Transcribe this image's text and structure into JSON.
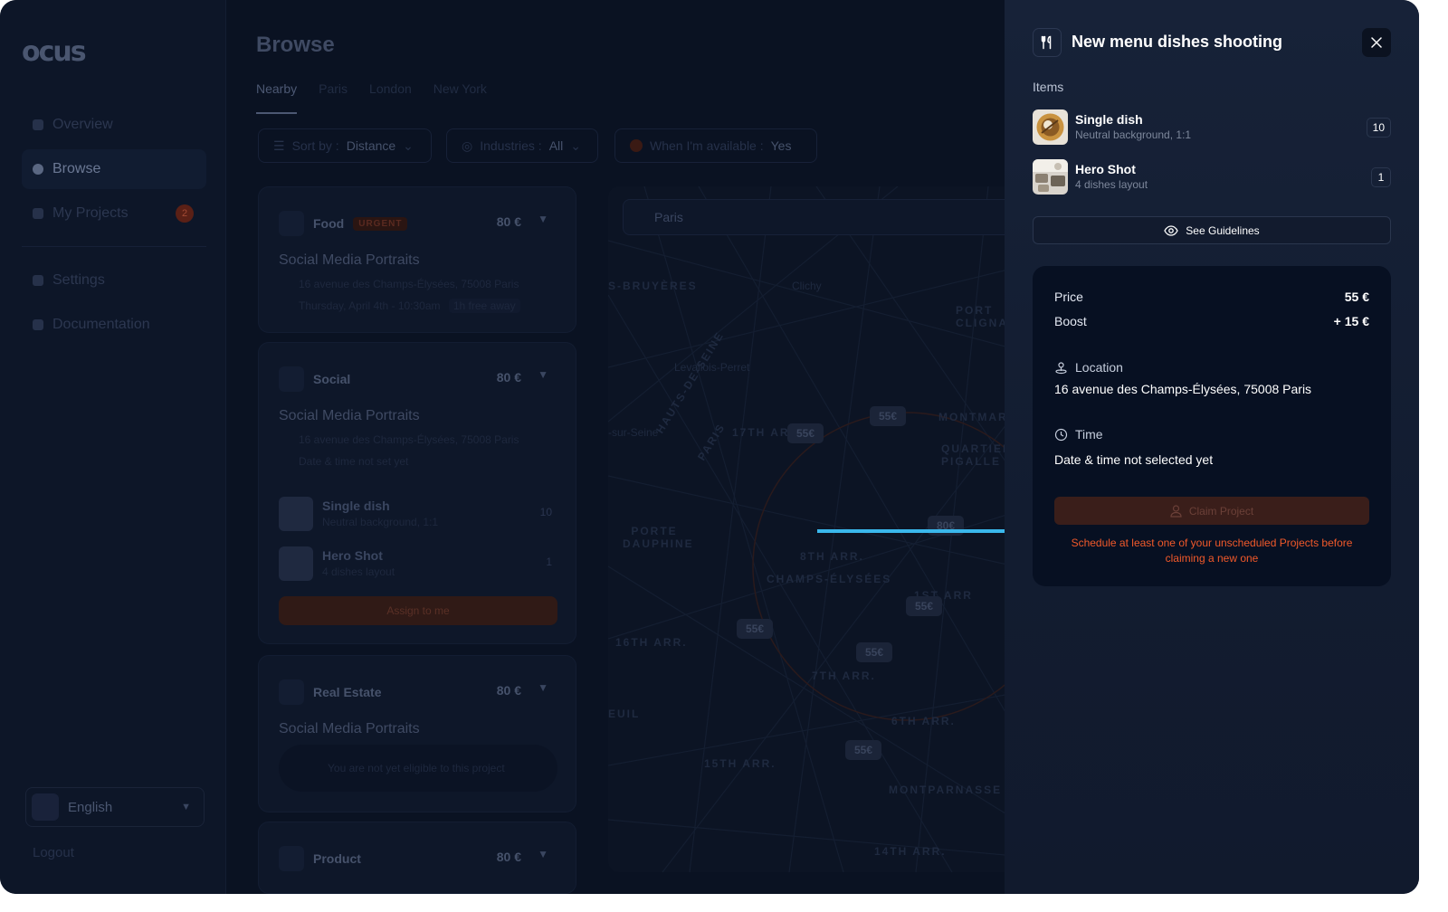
{
  "sidebar": {
    "logo": "ocus",
    "nav": [
      {
        "label": "Overview"
      },
      {
        "label": "Browse"
      },
      {
        "label": "My Projects",
        "badge": "2"
      },
      {
        "label": "Settings"
      },
      {
        "label": "Documentation"
      }
    ],
    "language": "English",
    "logout": "Logout"
  },
  "browse": {
    "title": "Browse",
    "tabs": [
      "Nearby",
      "Paris",
      "London",
      "New York"
    ],
    "filters": {
      "sort_prefix": "Sort by :",
      "sort_value": "Distance",
      "industries_prefix": "Industries :",
      "industries_value": "All",
      "availability_prefix": "When I'm available :",
      "availability_value": "Yes"
    },
    "cards": [
      {
        "category": "Food",
        "urgent": "URGENT",
        "price": "80 €",
        "title": "Social Media Portraits",
        "address": "16 avenue des Champs-Élysées, 75008 Paris",
        "time": "Thursday, April 4th - 10:30am",
        "tag": "1h free away"
      },
      {
        "category": "Social",
        "price": "80 €",
        "title": "Social Media Portraits",
        "address": "16 avenue des Champs-Élysées, 75008 Paris",
        "time": "Date & time not set yet",
        "items": [
          {
            "name": "Single dish",
            "desc": "Neutral background, 1:1",
            "qty": "10"
          },
          {
            "name": "Hero Shot",
            "desc": "4 dishes layout",
            "qty": "1"
          }
        ],
        "assign": "Assign to me"
      },
      {
        "category": "Real Estate",
        "price": "80 €",
        "title": "Social Media Portraits",
        "not_eligible": "You are not yet eligible to this project"
      },
      {
        "category": "Product",
        "price": "80 €"
      }
    ],
    "map": {
      "search": "Paris",
      "labels": [
        "S-BRUYÈRES",
        "Clichy",
        "PORT CLIGNAN",
        "Levallois-Perret",
        "MONTMART",
        "QUARTIER PIGALLE",
        "17TH AR",
        "-sur-Seine",
        "HAUTS-DE-SEINE",
        "PARIS",
        "PORTE DAUPHINE",
        "8TH ARR.",
        "CHAMPS-ÉLYSÉES",
        "1ST ARR",
        "16TH ARR.",
        "7TH ARR.",
        "6TH ARR.",
        "EUIL",
        "15TH ARR.",
        "MONTPARNASSE",
        "14TH ARR."
      ],
      "pins": [
        "55€",
        "55€",
        "80€",
        "55€",
        "55€",
        "55€",
        "55€"
      ]
    }
  },
  "drawer": {
    "icon": "fork-knife-icon",
    "title": "New menu dishes shooting",
    "items_label": "Items",
    "items": [
      {
        "name": "Single dish",
        "desc": "Neutral background, 1:1",
        "qty": "10"
      },
      {
        "name": "Hero Shot",
        "desc": "4 dishes layout",
        "qty": "1"
      }
    ],
    "guidelines_label": "See Guidelines",
    "price_label": "Price",
    "price_value": "55 €",
    "boost_label": "Boost",
    "boost_value": "+ 15 €",
    "location_label": "Location",
    "location_value": "16 avenue des Champs-Élysées, 75008 Paris",
    "time_label": "Time",
    "time_value": "Date & time not selected yet",
    "claim_label": "Claim Project",
    "warning": "Schedule at least one of your unscheduled Projects before claiming a new one"
  },
  "colors": {
    "accent_arrow": "#3ab8ec",
    "warning": "#f1592a",
    "panel": "#071022"
  }
}
